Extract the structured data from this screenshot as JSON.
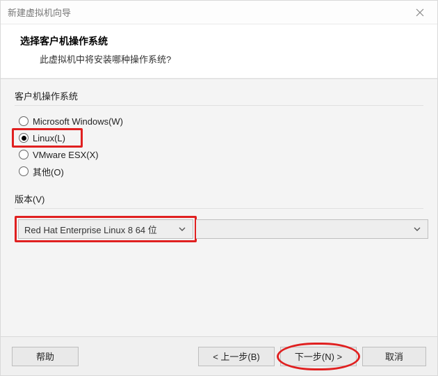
{
  "window": {
    "title": "新建虚拟机向导"
  },
  "header": {
    "title": "选择客户机操作系统",
    "subtitle": "此虚拟机中将安装哪种操作系统?"
  },
  "os_section": {
    "label": "客户机操作系统",
    "options": [
      {
        "label": "Microsoft Windows(W)",
        "selected": false
      },
      {
        "label": "Linux(L)",
        "selected": true
      },
      {
        "label": "VMware ESX(X)",
        "selected": false
      },
      {
        "label": "其他(O)",
        "selected": false
      }
    ]
  },
  "version_section": {
    "label": "版本(V)",
    "selected": "Red Hat Enterprise Linux 8 64 位"
  },
  "buttons": {
    "help": "帮助",
    "back": "< 上一步(B)",
    "next": "下一步(N) >",
    "cancel": "取消"
  }
}
